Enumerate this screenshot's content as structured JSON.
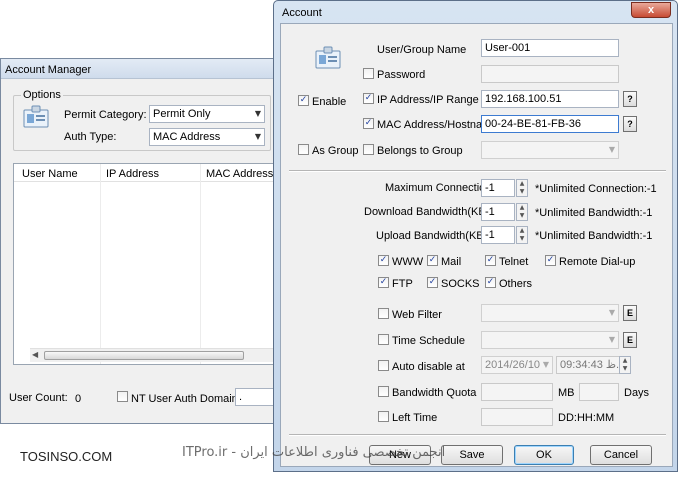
{
  "account_manager": {
    "title": "Account Manager",
    "options_label": "Options",
    "permit_category_label": "Permit Category:",
    "permit_category_value": "Permit Only",
    "auth_type_label": "Auth Type:",
    "auth_type_value": "MAC Address",
    "columns": [
      "User Name",
      "IP Address",
      "MAC Address"
    ],
    "user_count_label": "User Count:",
    "user_count_value": "0",
    "nt_domain_label": "NT User Auth Domain:",
    "nt_domain_value": "."
  },
  "account": {
    "title": "Account",
    "close_label": "x",
    "enable_label": "Enable",
    "as_group_label": "As Group",
    "user_group_name_label": "User/Group Name",
    "user_group_name_value": "User-001",
    "password_label": "Password",
    "ip_label": "IP Address/IP Range",
    "ip_value": "192.168.100.51",
    "mac_label": "MAC Address/Hostname",
    "mac_value": "00-24-BE-81-FB-36",
    "belongs_label": "Belongs to Group",
    "help_label": "?",
    "max_conn_label": "Maximum Connections",
    "max_conn_value": "-1",
    "max_conn_hint": "*Unlimited Connection:-1",
    "download_label": "Download Bandwidth(KB/s)",
    "download_value": "-1",
    "download_hint": "*Unlimited Bandwidth:-1",
    "upload_label": "Upload Bandwidth(KB/s)",
    "upload_value": "-1",
    "upload_hint": "*Unlimited Bandwidth:-1",
    "services": {
      "www": "WWW",
      "mail": "Mail",
      "telnet": "Telnet",
      "remote": "Remote Dial-up",
      "ftp": "FTP",
      "socks": "SOCKS",
      "others": "Others"
    },
    "web_filter_label": "Web Filter",
    "time_schedule_label": "Time Schedule",
    "edit_label": "E",
    "auto_disable_label": "Auto disable at",
    "auto_disable_date": "2014/26/10",
    "auto_disable_time": "09:34:43 ق.ظ",
    "bandwidth_quota_label": "Bandwidth Quota",
    "mb_label": "MB",
    "days_label": "Days",
    "left_time_label": "Left Time",
    "left_time_format": "DD:HH:MM",
    "new_label": "New",
    "save_label": "Save",
    "ok_label": "OK",
    "cancel_label": "Cancel",
    "check_mark": "✓"
  },
  "watermark": {
    "left_text": "TOSINSO.COM",
    "center_text": "انجمن تخصصی فناوری اطلاعات ایران - ITPro.ir"
  }
}
